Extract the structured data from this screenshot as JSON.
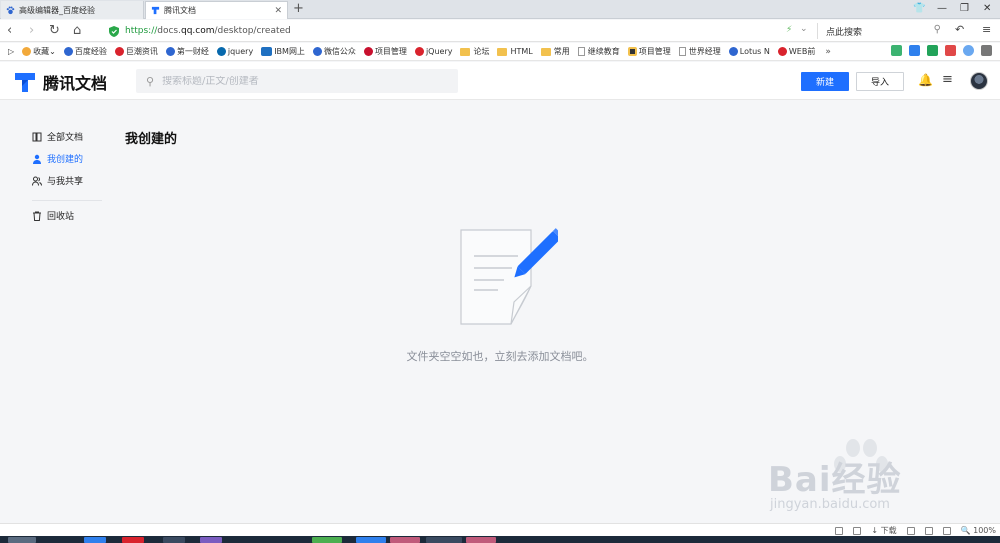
{
  "browser": {
    "tabs": [
      {
        "title": "高级编辑器_百度经验",
        "active": false
      },
      {
        "title": "腾讯文档",
        "active": true
      }
    ],
    "new_tab": "+",
    "window_controls": [
      "shirt-icon",
      "minimize-icon",
      "restore-icon",
      "close-icon"
    ],
    "url": {
      "protocol": "https://",
      "host_prefix": "docs.",
      "host": "qq.com",
      "path": "/desktop/created"
    },
    "search_placeholder": "点此搜索",
    "bookmarks": [
      {
        "label": "收藏",
        "icon": "star",
        "color": "#f2a93b",
        "dropdown": true
      },
      {
        "label": "百度经验",
        "icon": "paw",
        "color": "#2f66d0"
      },
      {
        "label": "巨潮资讯",
        "icon": "circle",
        "color": "#d9232d"
      },
      {
        "label": "第一财经",
        "icon": "paw",
        "color": "#2f66d0"
      },
      {
        "label": "jquery",
        "icon": "swirl",
        "color": "#0769ad"
      },
      {
        "label": "IBM网上",
        "icon": "ibm",
        "color": "#1f70c1"
      },
      {
        "label": "微信公众",
        "icon": "paw",
        "color": "#2f66d0"
      },
      {
        "label": "项目管理",
        "icon": "circle",
        "color": "#c8102e"
      },
      {
        "label": "jQuery",
        "icon": "circle",
        "color": "#d9232d"
      },
      {
        "label": "论坛",
        "icon": "folder",
        "color": "#f2c14e"
      },
      {
        "label": "HTML",
        "icon": "folder",
        "color": "#f2c14e"
      },
      {
        "label": "常用",
        "icon": "folder",
        "color": "#f2c14e"
      },
      {
        "label": "继续教育",
        "icon": "doc",
        "color": "#999999"
      },
      {
        "label": "项目管理",
        "icon": "grid",
        "color": "#333333"
      },
      {
        "label": "世界经理",
        "icon": "doc",
        "color": "#999999"
      },
      {
        "label": "Lotus N",
        "icon": "flower",
        "color": "#2f66d0"
      },
      {
        "label": "WEB前",
        "icon": "circle",
        "color": "#d9232d"
      }
    ],
    "bookmarks_more": "»",
    "statusbar": {
      "download": "下载",
      "zoom": "100%"
    }
  },
  "app": {
    "name": "腾讯文档",
    "search_placeholder": "搜索标题/正文/创建者",
    "new_button": "新建",
    "import_button": "导入",
    "nav": [
      {
        "label": "全部文档",
        "icon": "library-icon",
        "active": false
      },
      {
        "label": "我创建的",
        "icon": "user-icon",
        "active": true
      },
      {
        "label": "与我共享",
        "icon": "shared-users-icon",
        "active": false
      },
      {
        "label": "回收站",
        "icon": "trash-icon",
        "active": false
      }
    ],
    "page_title": "我创建的",
    "empty_message": "文件夹空空如也，立刻去添加文档吧。",
    "accent": "#1e6fff"
  },
  "watermark": {
    "text": "Bai经验",
    "url": "jingyan.baidu.com"
  }
}
